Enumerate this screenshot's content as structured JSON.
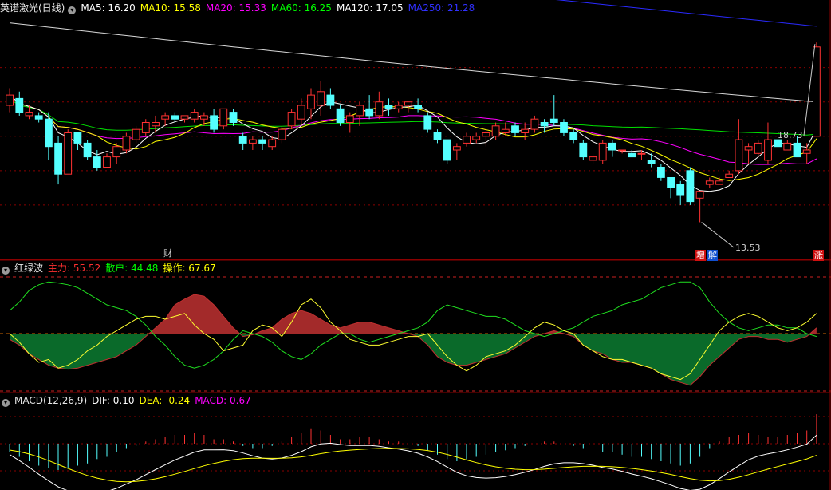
{
  "stock_title": "英诺激光(日线)",
  "main_legend": [
    {
      "label": "MA5: 16.20",
      "color": "#ffffff"
    },
    {
      "label": "MA10: 15.58",
      "color": "#ffff00"
    },
    {
      "label": "MA20: 15.33",
      "color": "#ff00ff"
    },
    {
      "label": "MA60: 16.25",
      "color": "#00ff00"
    },
    {
      "label": "MA120: 17.05",
      "color": "#ffffff"
    },
    {
      "label": "MA250: 21.28",
      "color": "#3030ff"
    }
  ],
  "max_label": "18.73",
  "min_label": "13.53",
  "markers": {
    "cai": "财",
    "zeng": "增",
    "jie": "解",
    "zhang": "涨"
  },
  "hlb": {
    "title": "红绿波",
    "items": [
      {
        "label": "主力: 55.52",
        "color": "#ff3030"
      },
      {
        "label": "散户: 44.48",
        "color": "#00ff00"
      },
      {
        "label": "操作: 67.67",
        "color": "#ffff00"
      }
    ]
  },
  "macd": {
    "title": "MACD(12,26,9)",
    "items": [
      {
        "label": "DIF: 0.10",
        "color": "#ffffff"
      },
      {
        "label": "DEA: -0.24",
        "color": "#ffff00"
      },
      {
        "label": "MACD: 0.67",
        "color": "#ff00ff"
      }
    ]
  },
  "colors": {
    "up": "#ff3232",
    "down": "#54ffff",
    "grid": "#8b0000",
    "ma250": "#2a2aff"
  },
  "chart_data": {
    "type": "candlestick",
    "candles": [
      [
        16.9,
        17.4,
        16.7,
        17.2
      ],
      [
        17.1,
        17.3,
        16.6,
        16.7
      ],
      [
        16.6,
        16.9,
        16.5,
        16.7
      ],
      [
        16.6,
        16.7,
        16.4,
        16.5
      ],
      [
        16.5,
        16.7,
        15.3,
        15.7
      ],
      [
        15.8,
        16.0,
        14.6,
        14.9
      ],
      [
        14.9,
        16.2,
        14.9,
        16.1
      ],
      [
        16.1,
        16.1,
        15.6,
        15.8
      ],
      [
        15.8,
        15.9,
        15.3,
        15.4
      ],
      [
        15.4,
        15.6,
        15.0,
        15.1
      ],
      [
        15.1,
        15.5,
        15.1,
        15.4
      ],
      [
        15.4,
        15.8,
        15.2,
        15.7
      ],
      [
        15.6,
        16.1,
        15.5,
        16.0
      ],
      [
        15.9,
        16.3,
        15.8,
        16.2
      ],
      [
        16.1,
        16.5,
        16.0,
        16.4
      ],
      [
        16.3,
        16.6,
        16.1,
        16.4
      ],
      [
        16.5,
        16.7,
        16.3,
        16.6
      ],
      [
        16.6,
        16.7,
        16.4,
        16.5
      ],
      [
        16.5,
        16.6,
        16.4,
        16.6
      ],
      [
        16.5,
        16.8,
        16.4,
        16.7
      ],
      [
        16.5,
        16.7,
        16.3,
        16.6
      ],
      [
        16.6,
        16.8,
        16.1,
        16.2
      ],
      [
        16.3,
        16.8,
        16.2,
        16.8
      ],
      [
        16.7,
        16.8,
        16.3,
        16.4
      ],
      [
        16.0,
        16.1,
        15.6,
        15.8
      ],
      [
        15.8,
        16.0,
        15.6,
        15.9
      ],
      [
        15.9,
        16.0,
        15.6,
        15.8
      ],
      [
        15.7,
        16.0,
        15.6,
        15.9
      ],
      [
        15.9,
        16.3,
        15.8,
        16.2
      ],
      [
        16.3,
        16.8,
        16.2,
        16.7
      ],
      [
        16.5,
        17.1,
        16.3,
        16.9
      ],
      [
        16.8,
        17.4,
        16.5,
        17.2
      ],
      [
        16.9,
        17.6,
        16.6,
        17.3
      ],
      [
        17.2,
        17.4,
        16.8,
        16.9
      ],
      [
        16.8,
        16.9,
        16.3,
        16.4
      ],
      [
        16.4,
        16.7,
        16.1,
        16.6
      ],
      [
        16.6,
        17.0,
        16.3,
        16.9
      ],
      [
        16.8,
        17.2,
        16.5,
        16.6
      ],
      [
        16.6,
        17.3,
        16.5,
        17.0
      ],
      [
        16.9,
        17.1,
        16.6,
        16.8
      ],
      [
        16.8,
        17.0,
        16.7,
        16.9
      ],
      [
        16.9,
        17.0,
        16.7,
        17.0
      ],
      [
        16.9,
        17.1,
        16.7,
        16.8
      ],
      [
        16.6,
        16.7,
        16.1,
        16.2
      ],
      [
        16.1,
        16.2,
        15.8,
        15.9
      ],
      [
        15.9,
        15.9,
        15.2,
        15.3
      ],
      [
        15.6,
        15.8,
        15.3,
        15.7
      ],
      [
        15.8,
        16.1,
        15.7,
        16.0
      ],
      [
        15.9,
        16.1,
        15.8,
        16.0
      ],
      [
        16.0,
        16.2,
        15.7,
        16.1
      ],
      [
        16.0,
        16.4,
        15.9,
        16.3
      ],
      [
        16.1,
        16.4,
        16.0,
        16.2
      ],
      [
        16.3,
        16.4,
        16.0,
        16.1
      ],
      [
        16.1,
        16.4,
        15.9,
        16.2
      ],
      [
        16.2,
        16.6,
        16.1,
        16.5
      ],
      [
        16.4,
        16.5,
        16.1,
        16.3
      ],
      [
        16.5,
        17.2,
        16.3,
        16.4
      ],
      [
        16.4,
        16.5,
        16.0,
        16.1
      ],
      [
        16.1,
        16.2,
        15.8,
        15.9
      ],
      [
        15.8,
        15.9,
        15.3,
        15.4
      ],
      [
        15.3,
        15.5,
        15.2,
        15.4
      ],
      [
        15.3,
        15.9,
        15.2,
        15.8
      ],
      [
        15.8,
        15.9,
        15.4,
        15.6
      ],
      [
        15.6,
        15.6,
        15.5,
        15.6
      ],
      [
        15.5,
        15.6,
        15.4,
        15.4
      ],
      [
        15.5,
        15.6,
        15.3,
        15.5
      ],
      [
        15.3,
        15.5,
        15.1,
        15.2
      ],
      [
        15.1,
        15.2,
        14.7,
        14.8
      ],
      [
        14.8,
        14.8,
        14.2,
        14.5
      ],
      [
        14.6,
        14.7,
        14.0,
        14.3
      ],
      [
        15.0,
        15.1,
        14.0,
        14.1
      ],
      [
        14.2,
        14.4,
        13.5,
        14.4
      ],
      [
        14.6,
        14.8,
        14.5,
        14.7
      ],
      [
        14.6,
        14.8,
        14.6,
        14.7
      ],
      [
        14.8,
        15.0,
        14.8,
        14.9
      ],
      [
        15.0,
        16.5,
        14.9,
        15.9
      ],
      [
        15.6,
        15.8,
        15.2,
        15.7
      ],
      [
        15.5,
        15.9,
        15.4,
        15.8
      ],
      [
        15.3,
        16.4,
        15.2,
        15.9
      ],
      [
        15.9,
        15.9,
        15.7,
        15.7
      ],
      [
        15.6,
        15.9,
        15.6,
        15.8
      ],
      [
        15.8,
        16.0,
        15.6,
        15.4
      ],
      [
        15.5,
        15.8,
        15.2,
        15.6
      ],
      [
        16.0,
        18.73,
        16.0,
        18.6
      ]
    ],
    "price_range": [
      13.0,
      19.5
    ],
    "hlb_range": [
      0,
      100
    ],
    "macd_range": [
      -0.8,
      0.75
    ]
  }
}
